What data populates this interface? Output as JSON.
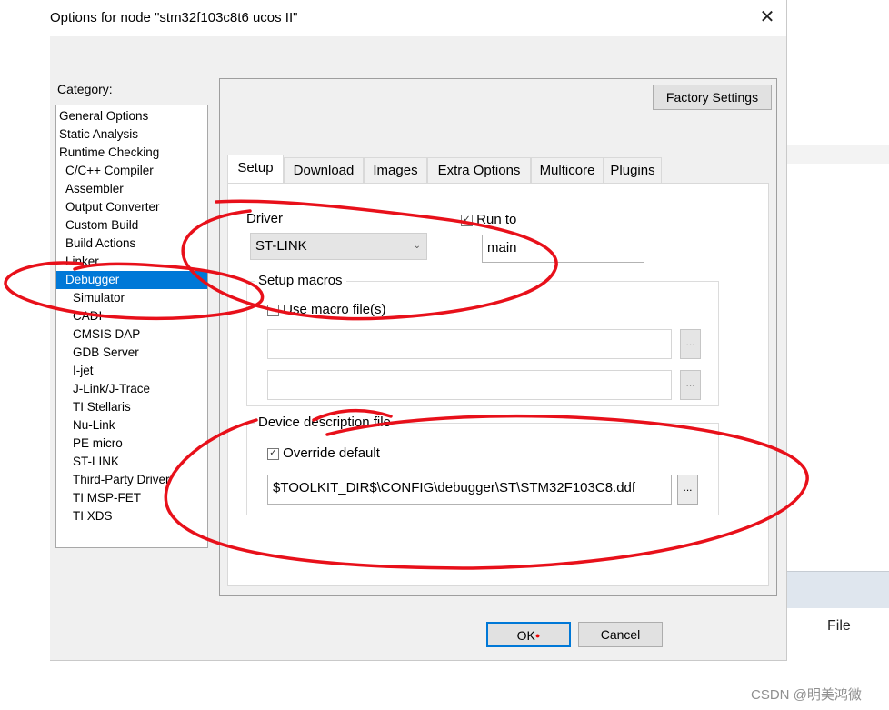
{
  "window": {
    "title": "Options for node \"stm32f103c8t6 ucos II\"",
    "close_icon": "close-icon"
  },
  "background": {
    "file_label": "File",
    "watermark": "CSDN @明美鸿微"
  },
  "category": {
    "label": "Category:",
    "selected": "Debugger",
    "items": [
      {
        "label": "General Options",
        "level": 0
      },
      {
        "label": "Static Analysis",
        "level": 0
      },
      {
        "label": "Runtime Checking",
        "level": 0
      },
      {
        "label": "C/C++ Compiler",
        "level": 1
      },
      {
        "label": "Assembler",
        "level": 1
      },
      {
        "label": "Output Converter",
        "level": 1
      },
      {
        "label": "Custom Build",
        "level": 1
      },
      {
        "label": "Build Actions",
        "level": 1
      },
      {
        "label": "Linker",
        "level": 1
      },
      {
        "label": "Debugger",
        "level": 1
      },
      {
        "label": "Simulator",
        "level": 2
      },
      {
        "label": "CADI",
        "level": 2
      },
      {
        "label": "CMSIS DAP",
        "level": 2
      },
      {
        "label": "GDB Server",
        "level": 2
      },
      {
        "label": "I-jet",
        "level": 2
      },
      {
        "label": "J-Link/J-Trace",
        "level": 2
      },
      {
        "label": "TI Stellaris",
        "level": 2
      },
      {
        "label": "Nu-Link",
        "level": 2
      },
      {
        "label": "PE micro",
        "level": 2
      },
      {
        "label": "ST-LINK",
        "level": 2
      },
      {
        "label": "Third-Party Driver",
        "level": 2
      },
      {
        "label": "TI MSP-FET",
        "level": 2
      },
      {
        "label": "TI XDS",
        "level": 2
      }
    ]
  },
  "factory_settings_label": "Factory Settings",
  "tabs": [
    {
      "label": "Setup",
      "active": true
    },
    {
      "label": "Download",
      "active": false
    },
    {
      "label": "Images",
      "active": false
    },
    {
      "label": "Extra Options",
      "active": false
    },
    {
      "label": "Multicore",
      "active": false
    },
    {
      "label": "Plugins",
      "active": false
    }
  ],
  "setup": {
    "driver_label": "Driver",
    "driver_value": "ST-LINK",
    "run_to_label": "Run to",
    "run_to_checked": true,
    "run_to_value": "main",
    "macros_group": "Setup macros",
    "use_macro_label": "Use macro file(s)",
    "use_macro_checked": false,
    "macro_file_1": "",
    "macro_file_2": "",
    "browse_label": "...",
    "ddf_group": "Device description file",
    "override_label": "Override default",
    "override_checked": true,
    "ddf_path": "$TOOLKIT_DIR$\\CONFIG\\debugger\\ST\\STM32F103C8.ddf"
  },
  "buttons": {
    "ok": "OK",
    "cancel": "Cancel"
  },
  "colors": {
    "selection": "#0078d7",
    "annotation": "#e8101a",
    "dialog_bg": "#f0f0f0"
  }
}
